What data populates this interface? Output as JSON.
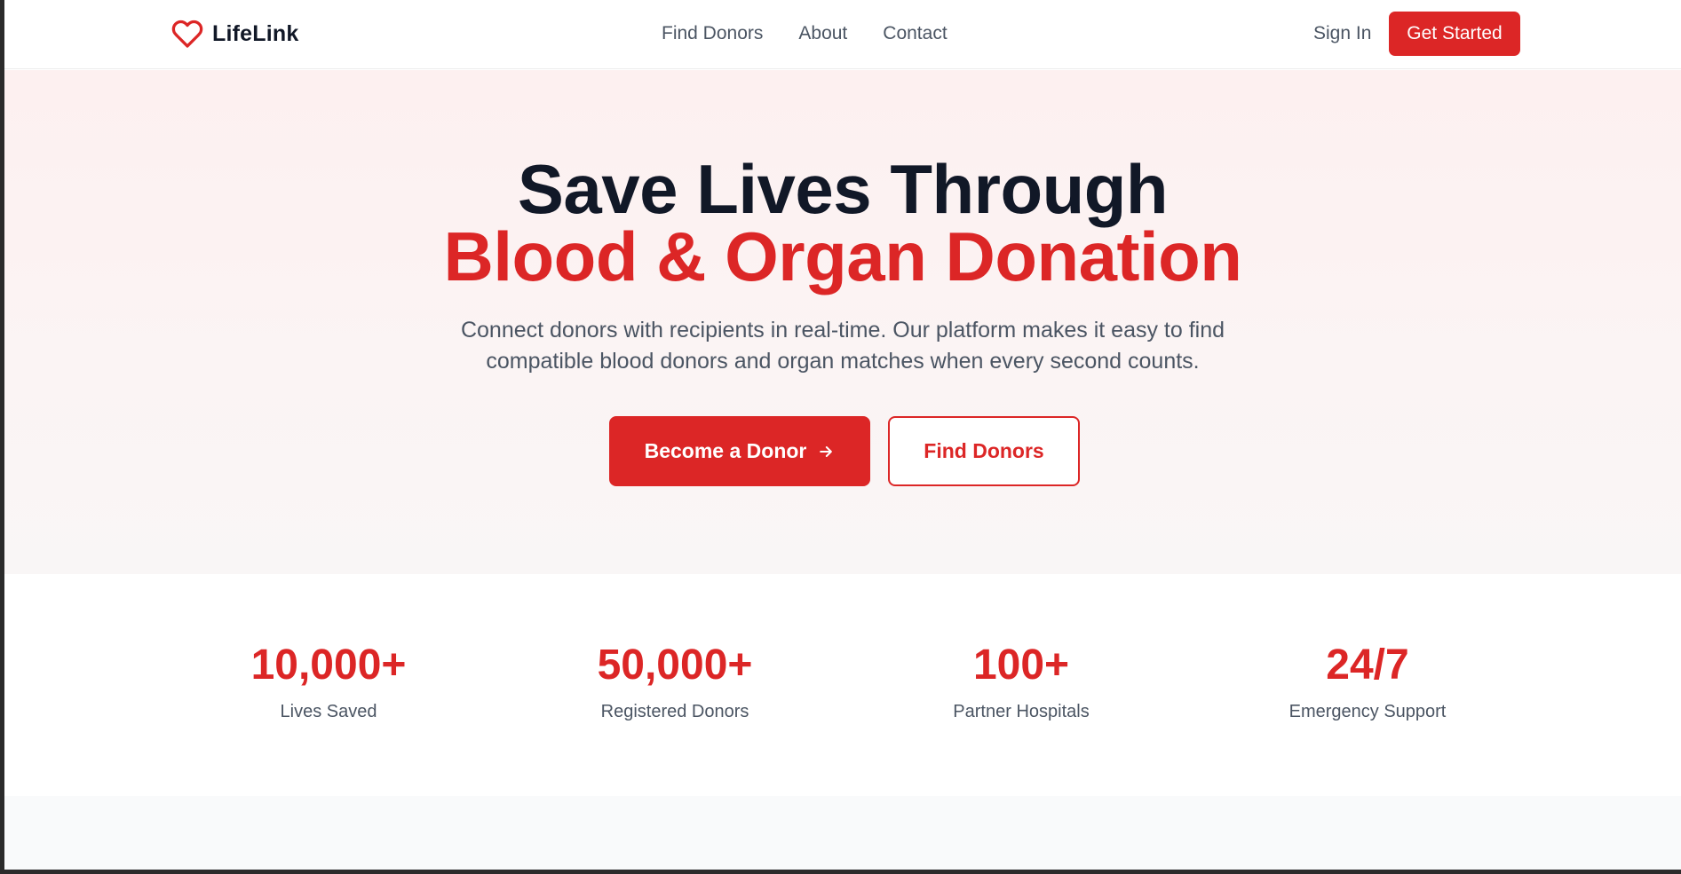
{
  "brand": {
    "name": "LifeLink",
    "logo_icon": "heart-outline-icon",
    "accent": "#dc2626"
  },
  "nav": {
    "links": [
      {
        "label": "Find Donors"
      },
      {
        "label": "About"
      },
      {
        "label": "Contact"
      }
    ],
    "sign_in": "Sign In",
    "get_started": "Get Started"
  },
  "hero": {
    "title_line1": "Save Lives Through",
    "title_line2": "Blood & Organ Donation",
    "subtitle_line1": "Connect donors with recipients in real-time. Our platform makes it easy to find",
    "subtitle_line2": "compatible blood donors and organ matches when every second counts.",
    "primary_cta": "Become a Donor",
    "primary_cta_icon": "arrow-right-icon",
    "secondary_cta": "Find Donors"
  },
  "stats": [
    {
      "value": "10,000+",
      "label": "Lives Saved"
    },
    {
      "value": "50,000+",
      "label": "Registered Donors"
    },
    {
      "value": "100+",
      "label": "Partner Hospitals"
    },
    {
      "value": "24/7",
      "label": "Emergency Support"
    }
  ]
}
